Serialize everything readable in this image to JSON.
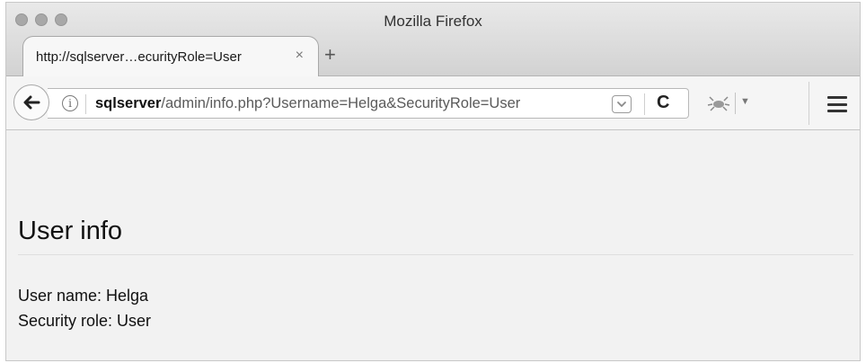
{
  "window": {
    "title": "Mozilla Firefox"
  },
  "tab": {
    "title": "http://sqlserver…ecurityRole=User",
    "close_glyph": "×",
    "new_tab_glyph": "+"
  },
  "urlbar": {
    "host": "sqlserver",
    "path": "/admin/info.php?Username=Helga&SecurityRole=User",
    "info_glyph": "i",
    "reload_glyph": "C"
  },
  "page": {
    "heading": "User info",
    "user_name_line": "User name: Helga",
    "security_role_line": "Security role: User"
  },
  "icons": {
    "close": "close-icon",
    "minimize": "minimize-icon",
    "zoom": "zoom-icon",
    "back": "back-arrow-icon",
    "info": "info-icon",
    "pocket": "pocket-icon",
    "reload": "reload-icon",
    "bug": "bug-icon",
    "menu": "hamburger-menu-icon"
  },
  "colors": {
    "window_bg": "#f2f2f2",
    "titlebar": "#d2d2d2",
    "traffic_light": "#a8a8a8",
    "text": "#111111"
  }
}
